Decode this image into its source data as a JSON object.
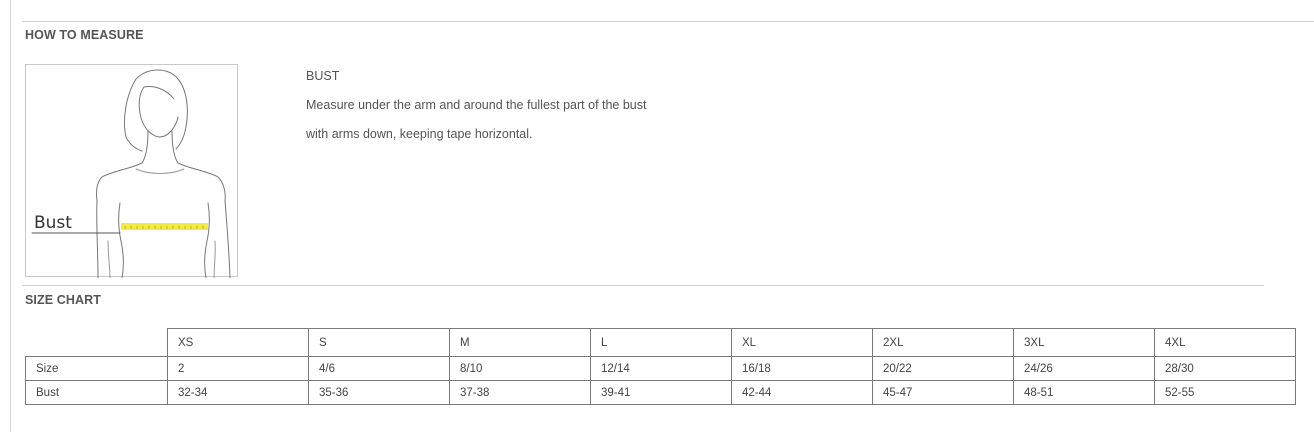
{
  "how_to_measure": {
    "title": "HOW TO MEASURE",
    "figure_label": "Bust",
    "bust_title": "BUST",
    "bust_line1": "Measure under the arm and around the fullest part of the bust",
    "bust_line2": "with arms down, keeping tape horizontal.",
    "tape_color": "#f0ea4a"
  },
  "size_chart": {
    "title": "SIZE CHART",
    "sizes": [
      "XS",
      "S",
      "M",
      "L",
      "XL",
      "2XL",
      "3XL",
      "4XL"
    ],
    "rows": [
      {
        "label": "Size",
        "values": [
          "2",
          "4/6",
          "8/10",
          "12/14",
          "16/18",
          "20/22",
          "24/26",
          "28/30"
        ]
      },
      {
        "label": "Bust",
        "values": [
          "32-34",
          "35-36",
          "37-38",
          "39-41",
          "42-44",
          "45-47",
          "48-51",
          "52-55"
        ]
      }
    ]
  }
}
